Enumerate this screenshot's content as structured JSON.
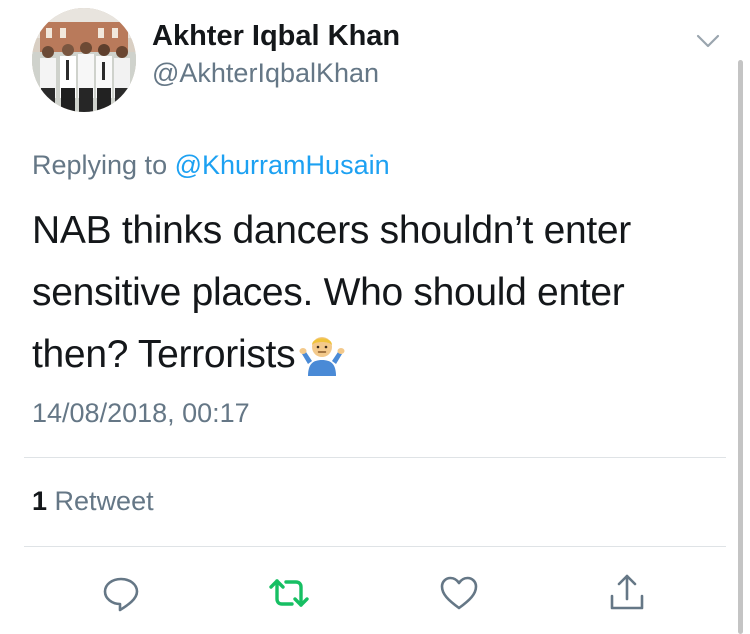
{
  "user": {
    "display_name": "Akhter Iqbal Khan",
    "handle": "@AkhterIqbalKhan"
  },
  "reply_context": {
    "prefix": "Replying to",
    "mention": "@KhurramHusain"
  },
  "tweet": {
    "text": "NAB thinks dancers shouldn’t enter sensitive places. Who should enter then? Terrorists",
    "emoji_icon": "person-shrugging-emoji",
    "timestamp": "14/08/2018, 00:17"
  },
  "stats": {
    "retweet_count": "1",
    "retweet_label": "Retweet"
  },
  "actions": [
    {
      "icon": "reply-icon"
    },
    {
      "icon": "retweet-icon",
      "color": "#17bf63"
    },
    {
      "icon": "heart-icon"
    },
    {
      "icon": "share-icon"
    }
  ],
  "colors": {
    "text": "#14171a",
    "secondary": "#657786",
    "link": "#1da1f2",
    "retweeted": "#17bf63",
    "divider": "#dfe3e6"
  }
}
